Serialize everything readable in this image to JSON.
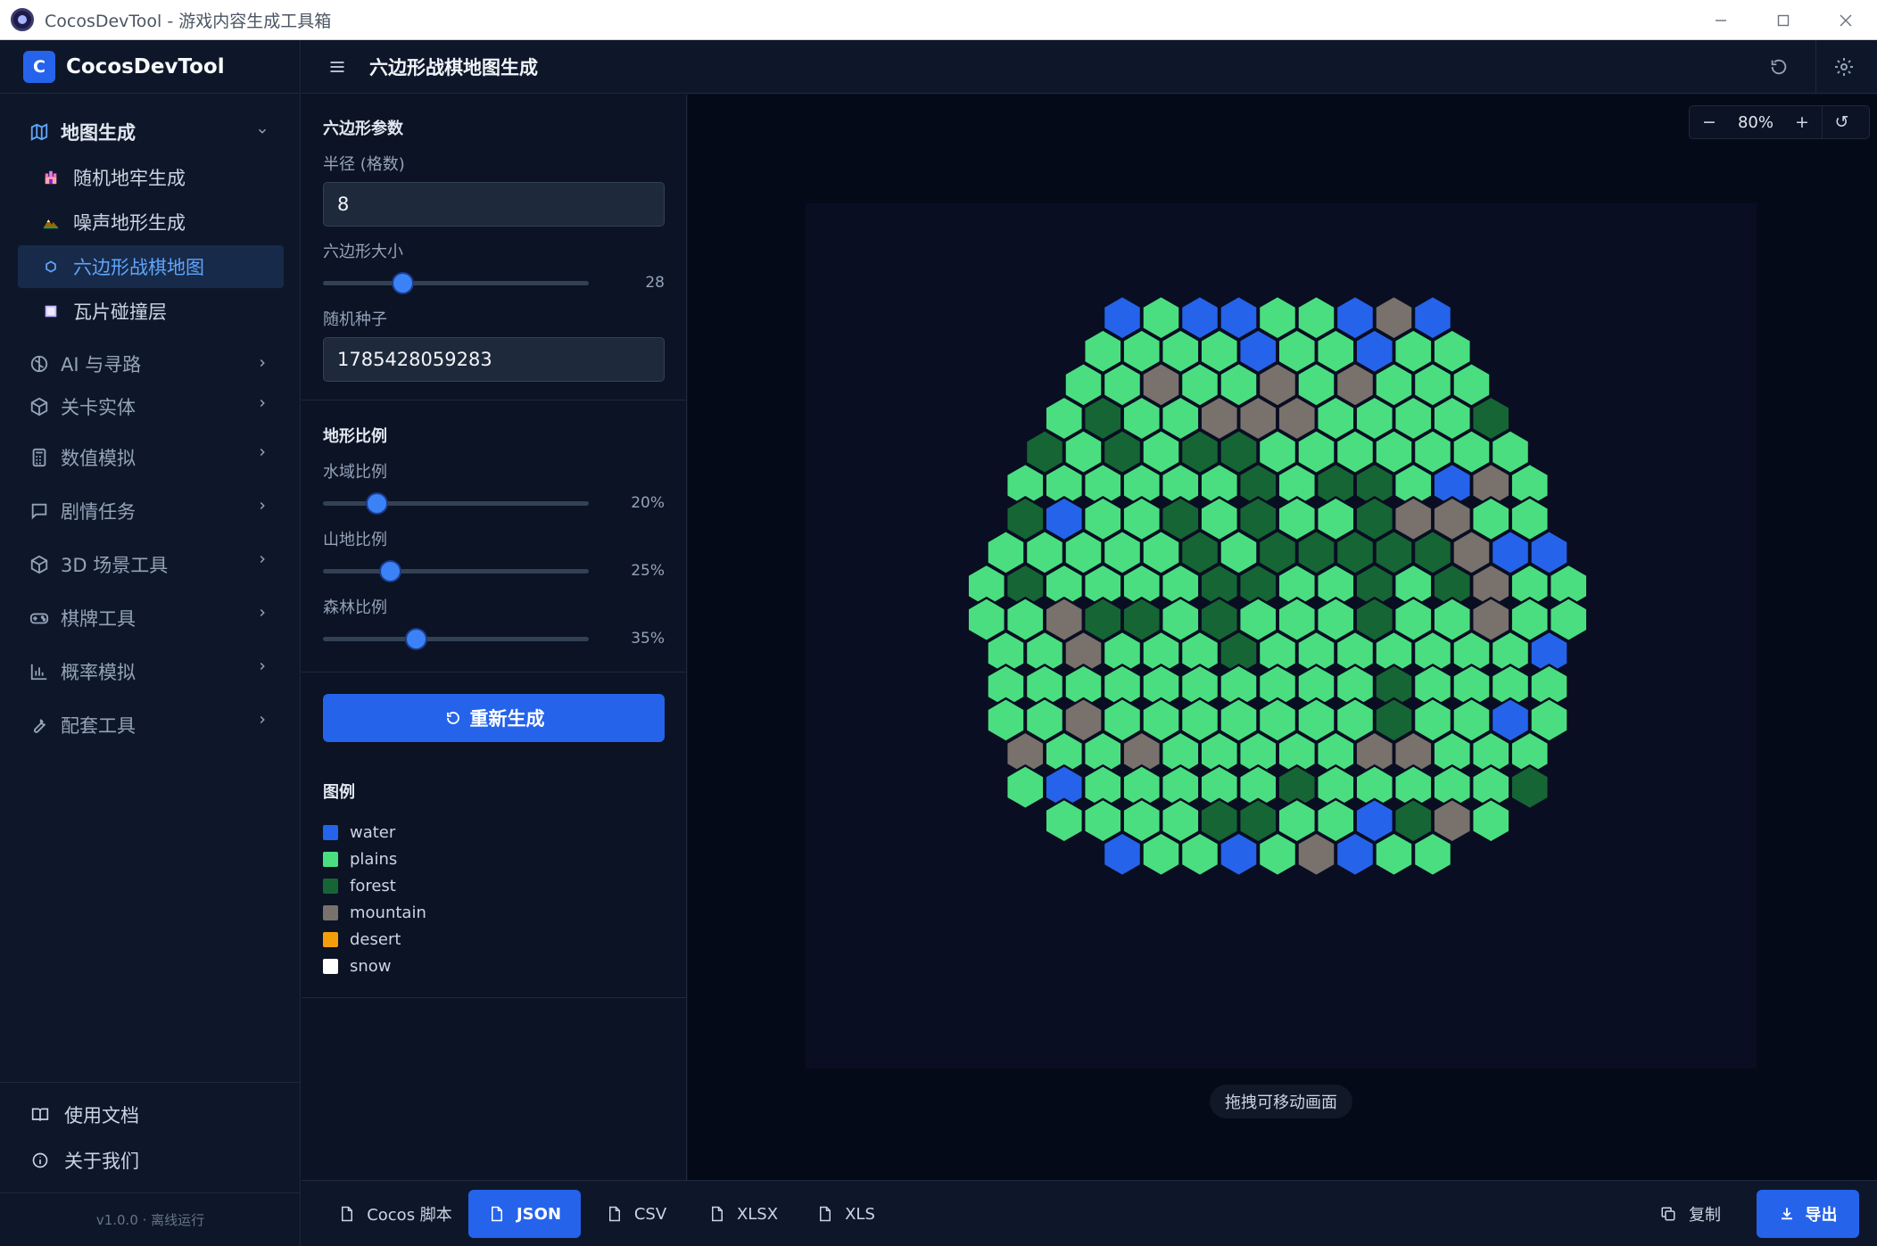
{
  "window": {
    "title": "CocosDevTool - 游戏内容生成工具箱"
  },
  "brand": {
    "logo_letter": "C",
    "name": "CocosDevTool"
  },
  "sidebar": {
    "groups": [
      {
        "label": "地图生成",
        "icon": "map-icon",
        "open": true,
        "items": [
          {
            "label": "随机地牢生成",
            "icon": "castle-icon"
          },
          {
            "label": "噪声地形生成",
            "icon": "mountain-icon"
          },
          {
            "label": "六边形战棋地图",
            "icon": "hexagon-icon",
            "active": true
          },
          {
            "label": "瓦片碰撞层",
            "icon": "tile-icon"
          }
        ]
      },
      {
        "label": "AI 与寻路",
        "icon": "brain-icon"
      },
      {
        "label": "关卡实体",
        "icon": "box-icon"
      },
      {
        "label": "数值模拟",
        "icon": "calculator-icon"
      },
      {
        "label": "剧情任务",
        "icon": "chat-icon"
      },
      {
        "label": "3D 场景工具",
        "icon": "cube-icon"
      },
      {
        "label": "棋牌工具",
        "icon": "gamepad-icon"
      },
      {
        "label": "概率模拟",
        "icon": "bar-chart-icon"
      },
      {
        "label": "配套工具",
        "icon": "wrench-icon"
      }
    ],
    "bottom": [
      {
        "label": "使用文档",
        "icon": "book-icon"
      },
      {
        "label": "关于我们",
        "icon": "info-icon"
      }
    ],
    "version": "v1.0.0 · 离线运行"
  },
  "header": {
    "title": "六边形战棋地图生成"
  },
  "params": {
    "section_title": "六边形参数",
    "radius_label": "半径 (格数)",
    "radius_value": "8",
    "hex_size_label": "六边形大小",
    "hex_size_value": "28",
    "hex_size_fraction": 0.3,
    "seed_label": "随机种子",
    "seed_value": "1785428059283"
  },
  "terrain": {
    "section_title": "地形比例",
    "water_label": "水域比例",
    "water_value": "20%",
    "water_fraction": 0.2,
    "mountain_label": "山地比例",
    "mountain_value": "25%",
    "mountain_fraction": 0.25,
    "forest_label": "森林比例",
    "forest_value": "35%",
    "forest_fraction": 0.35
  },
  "regenerate_label": "重新生成",
  "legend": {
    "title": "图例",
    "items": [
      {
        "label": "water",
        "color": "#2563eb"
      },
      {
        "label": "plains",
        "color": "#4ade80"
      },
      {
        "label": "forest",
        "color": "#166534"
      },
      {
        "label": "mountain",
        "color": "#78716c"
      },
      {
        "label": "desert",
        "color": "#f59e0b"
      },
      {
        "label": "snow",
        "color": "#ffffff"
      }
    ]
  },
  "canvas": {
    "zoom_minus": "−",
    "zoom_level": "80%",
    "zoom_plus": "+",
    "zoom_reset": "↺",
    "drag_hint": "拖拽可移动画面",
    "hex_rows": [
      "WPWWPPWMW",
      "PPPPWPPWPP",
      "PPMPPMPMPPP",
      "PFPPMMMPPPPF",
      "FPFPFFPPPPPPP",
      "PPPPPPFPFFPWMP",
      "FWPPFPFPPFMMPP",
      "PPPPPFPFFFFFMWW",
      "PFPPPPFFPPFPFMPP",
      "PPMFFPFPPPFPPMPP",
      "PPMPPPFPPPPPPPW",
      "PPPPPPPPPPFPPPP",
      "PPMPPPPPPPFPPWP",
      "MPPMPPPPPMMPPP",
      "PWPPPPPFPPPPPF",
      "PPPPFFPPWFMP",
      "WPPWPMWPP"
    ]
  },
  "bottombar": {
    "formats": [
      {
        "label": "Cocos 脚本"
      },
      {
        "label": "JSON",
        "active": true
      },
      {
        "label": "CSV"
      },
      {
        "label": "XLSX"
      },
      {
        "label": "XLS"
      }
    ],
    "copy_label": "复制",
    "export_label": "导出"
  }
}
